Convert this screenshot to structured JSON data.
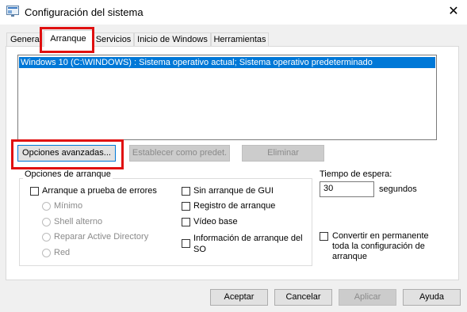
{
  "window": {
    "title": "Configuración del sistema",
    "close_glyph": "✕"
  },
  "tabs": [
    {
      "label": "General"
    },
    {
      "label": "Arranque"
    },
    {
      "label": "Servicios"
    },
    {
      "label": "Inicio de Windows"
    },
    {
      "label": "Herramientas"
    }
  ],
  "boot_list": {
    "entries": [
      "Windows 10 (C:\\WINDOWS) : Sistema operativo actual; Sistema operativo predeterminado"
    ]
  },
  "boot_buttons": {
    "advanced": "Opciones avanzadas...",
    "set_default": "Establecer como predet.",
    "delete": "Eliminar"
  },
  "boot_options": {
    "title": "Opciones de arranque",
    "safe_boot": "Arranque a prueba de errores",
    "minimal": "Mínimo",
    "alternate_shell": "Shell alterno",
    "ad_repair": "Reparar Active Directory",
    "network": "Red",
    "no_gui": "Sin arranque de GUI",
    "boot_log": "Registro de arranque",
    "base_video": "Vídeo base",
    "os_boot_info": "Información de arranque del SO"
  },
  "timeout": {
    "label": "Tiempo de espera:",
    "value": "30",
    "unit": "segundos"
  },
  "permanent": {
    "label": "Convertir en permanente toda la configuración de arranque"
  },
  "footer": {
    "ok": "Aceptar",
    "cancel": "Cancelar",
    "apply": "Aplicar",
    "help": "Ayuda"
  },
  "colors": {
    "selection": "#0078d7",
    "highlight": "#e01010"
  },
  "icons": {
    "app": "msconfig-icon"
  }
}
